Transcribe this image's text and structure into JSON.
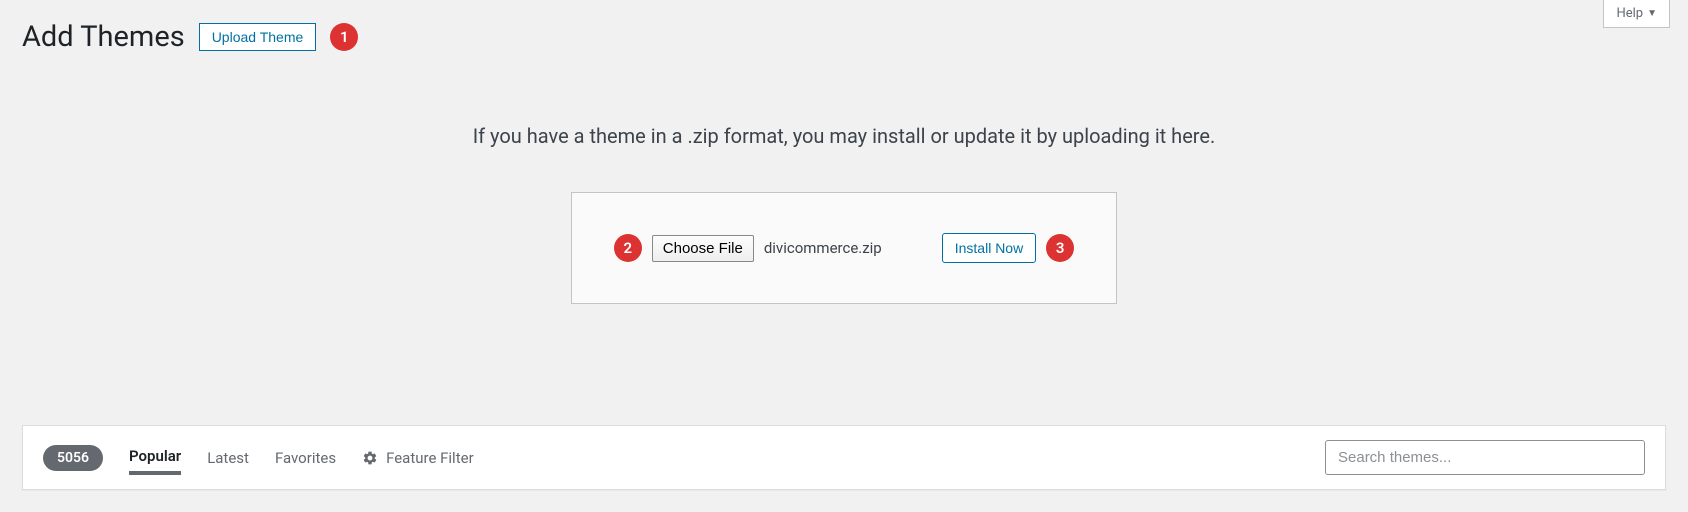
{
  "help": {
    "label": "Help"
  },
  "header": {
    "title": "Add Themes",
    "upload_label": "Upload Theme",
    "badge1": "1"
  },
  "upload": {
    "instruction": "If you have a theme in a .zip format, you may install or update it by uploading it here.",
    "badge2": "2",
    "choose_file_label": "Choose File",
    "filename": "divicommerce.zip",
    "install_label": "Install Now",
    "badge3": "3"
  },
  "filter": {
    "count": "5056",
    "popular": "Popular",
    "latest": "Latest",
    "favorites": "Favorites",
    "feature_filter": "Feature Filter",
    "search_placeholder": "Search themes..."
  }
}
